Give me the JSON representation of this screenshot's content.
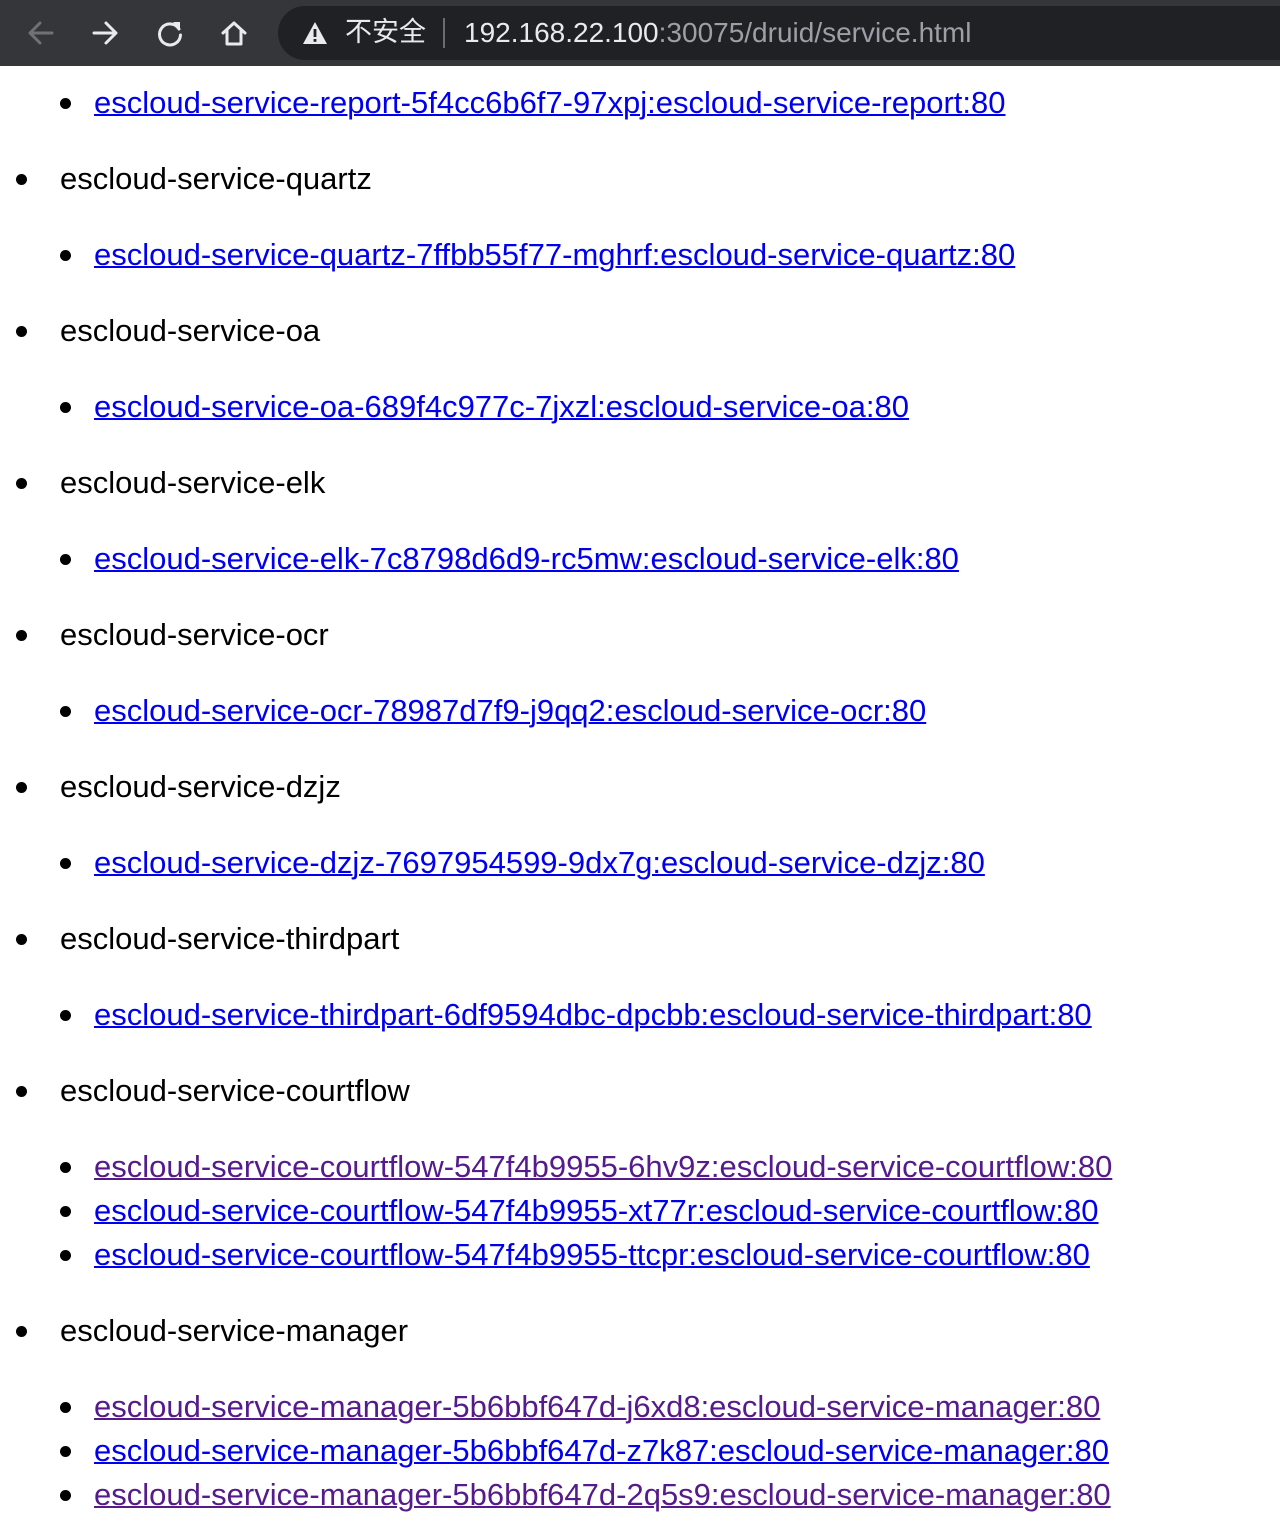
{
  "browser": {
    "security_label": "不安全",
    "url_host": "192.168.22.100",
    "url_path": ":30075/druid/service.html"
  },
  "page": {
    "top_link": {
      "text": "escloud-service-report-5f4cc6b6f7-97xpj:escloud-service-report:80",
      "visited": false
    },
    "services": [
      {
        "name": "escloud-service-quartz",
        "pods": [
          {
            "text": "escloud-service-quartz-7ffbb55f77-mghrf:escloud-service-quartz:80",
            "visited": false
          }
        ]
      },
      {
        "name": "escloud-service-oa",
        "pods": [
          {
            "text": "escloud-service-oa-689f4c977c-7jxzl:escloud-service-oa:80",
            "visited": false
          }
        ]
      },
      {
        "name": "escloud-service-elk",
        "pods": [
          {
            "text": "escloud-service-elk-7c8798d6d9-rc5mw:escloud-service-elk:80",
            "visited": false
          }
        ]
      },
      {
        "name": "escloud-service-ocr",
        "pods": [
          {
            "text": "escloud-service-ocr-78987d7f9-j9qq2:escloud-service-ocr:80",
            "visited": false
          }
        ]
      },
      {
        "name": "escloud-service-dzjz",
        "pods": [
          {
            "text": "escloud-service-dzjz-7697954599-9dx7g:escloud-service-dzjz:80",
            "visited": false
          }
        ]
      },
      {
        "name": "escloud-service-thirdpart",
        "pods": [
          {
            "text": "escloud-service-thirdpart-6df9594dbc-dpcbb:escloud-service-thirdpart:80",
            "visited": false
          }
        ]
      },
      {
        "name": "escloud-service-courtflow",
        "pods": [
          {
            "text": "escloud-service-courtflow-547f4b9955-6hv9z:escloud-service-courtflow:80",
            "visited": true
          },
          {
            "text": "escloud-service-courtflow-547f4b9955-xt77r:escloud-service-courtflow:80",
            "visited": false
          },
          {
            "text": "escloud-service-courtflow-547f4b9955-ttcpr:escloud-service-courtflow:80",
            "visited": false
          }
        ]
      },
      {
        "name": "escloud-service-manager",
        "pods": [
          {
            "text": "escloud-service-manager-5b6bbf647d-j6xd8:escloud-service-manager:80",
            "visited": true
          },
          {
            "text": "escloud-service-manager-5b6bbf647d-z7k87:escloud-service-manager:80",
            "visited": false
          },
          {
            "text": "escloud-service-manager-5b6bbf647d-2q5s9:escloud-service-manager:80",
            "visited": true
          }
        ]
      }
    ]
  },
  "colors": {
    "toolbar_bg": "#35363a",
    "omnibox_bg": "#202124",
    "link": "#0000ee",
    "link_visited": "#551a8b",
    "text": "#000000"
  }
}
